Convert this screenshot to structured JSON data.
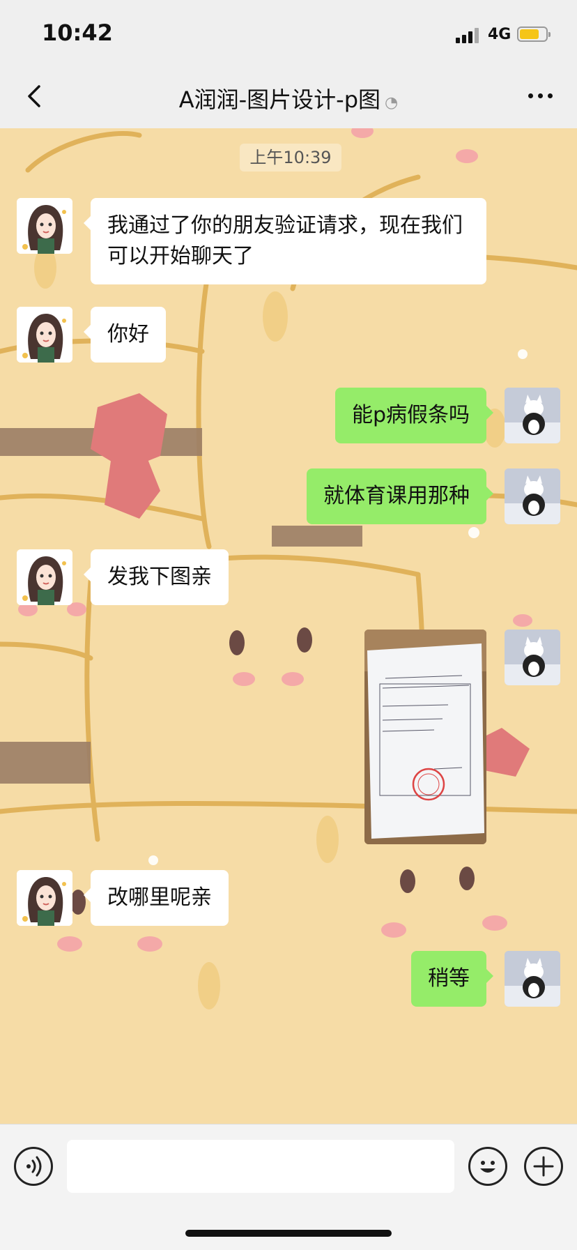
{
  "status": {
    "time": "10:42",
    "network": "4G",
    "battery_level": 0.75
  },
  "nav": {
    "title": "A润润-图片设计-p图",
    "muted_icon": "ear-icon"
  },
  "chat": {
    "timestamp": "上午10:39",
    "messages": [
      {
        "from": "contact",
        "text": "我通过了你的朋友验证请求，现在我们可以开始聊天了"
      },
      {
        "from": "contact",
        "text": "你好"
      },
      {
        "from": "me",
        "text": "能p病假条吗"
      },
      {
        "from": "me",
        "text": "就体育课用那种"
      },
      {
        "from": "contact",
        "text": "发我下图亲"
      },
      {
        "from": "me",
        "type": "image"
      },
      {
        "from": "contact",
        "text": "改哪里呢亲"
      },
      {
        "from": "me",
        "text": "稍等"
      }
    ]
  },
  "input": {
    "placeholder": ""
  },
  "colors": {
    "incoming_bubble": "#ffffff",
    "outgoing_bubble": "#95ec69",
    "bar_bg": "#efefef",
    "wallpaper": "#f6dca6"
  }
}
